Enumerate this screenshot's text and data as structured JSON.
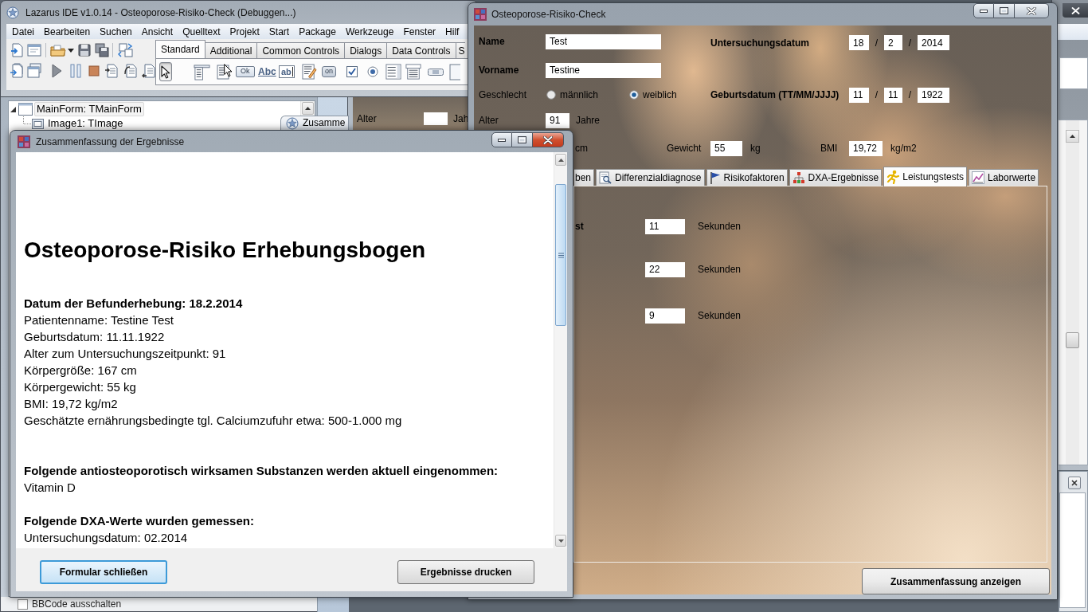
{
  "ide": {
    "title": "Lazarus IDE v1.0.14 - Osteoporose-Risiko-Check (Debuggen...)",
    "menu": [
      "Datei",
      "Bearbeiten",
      "Suchen",
      "Ansicht",
      "Quelltext",
      "Projekt",
      "Start",
      "Package",
      "Werkzeuge",
      "Fenster",
      "Hilf"
    ],
    "palette_tabs": [
      {
        "label": "Standard",
        "selected": true
      },
      {
        "label": "Additional",
        "selected": false
      },
      {
        "label": "Common Controls",
        "selected": false
      },
      {
        "label": "Dialogs",
        "selected": false
      },
      {
        "label": "Data Controls",
        "selected": false
      },
      {
        "label": "S",
        "selected": false
      }
    ],
    "palette": [
      {
        "kind": "pointer",
        "selected": true
      },
      {
        "kind": "main-menu",
        "selected": false
      },
      {
        "kind": "popup-menu",
        "selected": false
      },
      {
        "kind": "button",
        "text": "Ok",
        "selected": false
      },
      {
        "kind": "label",
        "text": "Abc",
        "selected": false
      },
      {
        "kind": "edit",
        "text": "ab",
        "selected": false
      },
      {
        "kind": "memo",
        "selected": false
      },
      {
        "kind": "toggle",
        "text": "on",
        "selected": false
      },
      {
        "kind": "checkbox",
        "selected": false
      },
      {
        "kind": "radio",
        "selected": false
      },
      {
        "kind": "listbox",
        "selected": false
      },
      {
        "kind": "combobox",
        "selected": false
      },
      {
        "kind": "scrollbar",
        "selected": false
      },
      {
        "kind": "panel",
        "selected": false
      }
    ]
  },
  "object_tree": {
    "items": [
      {
        "label": "MainForm: TMainForm",
        "selected": true,
        "expanded": true,
        "children": [
          {
            "label": "Image1: TImage",
            "selected": false
          }
        ]
      }
    ]
  },
  "inspector_option": {
    "label": "BBCode ausschalten",
    "checked": false
  },
  "editor_tab": {
    "label": "Zusamme"
  },
  "designer": {
    "label": "Alter",
    "unit": "Jah"
  },
  "main_form": {
    "title": "Osteoporose-Risiko-Check",
    "active": false,
    "name": {
      "label": "Name",
      "value": "Test"
    },
    "first_name": {
      "label": "Vorname",
      "value": "Testine"
    },
    "exam_date": {
      "label": "Untersuchungsdatum",
      "parts": [
        "18",
        "2",
        "2014"
      ],
      "separators": [
        "/",
        "/"
      ]
    },
    "gender": {
      "label": "Geschlecht",
      "options": [
        {
          "label": "männlich",
          "selected": false
        },
        {
          "label": "weiblich",
          "selected": true
        }
      ]
    },
    "birth_date": {
      "label": "Geburtsdatum (TT/MM/JJJJ)",
      "parts": [
        "11",
        "11",
        "1922"
      ],
      "separators": [
        "/",
        "/"
      ]
    },
    "age": {
      "label": "Alter",
      "value": "91",
      "unit": "Jahre"
    },
    "measurements": [
      {
        "unit": "cm"
      },
      {
        "label": "Gewicht",
        "value": "55",
        "unit": "kg"
      },
      {
        "label": "BMI",
        "value": "19,72",
        "unit": "kg/m2"
      }
    ],
    "tabs": [
      {
        "label": "ben",
        "selected": false
      },
      {
        "label": "Differenzialdiagnose",
        "selected": false
      },
      {
        "label": "Risikofaktoren",
        "selected": false
      },
      {
        "label": "DXA-Ergebnisse",
        "selected": false
      },
      {
        "label": "Leistungstests",
        "selected": true
      },
      {
        "label": "Laborwerte",
        "selected": false
      }
    ],
    "tests": [
      {
        "label": "st",
        "value": "11",
        "unit": "Sekunden"
      },
      {
        "value": "22",
        "unit": "Sekunden"
      },
      {
        "value": "9",
        "unit": "Sekunden"
      }
    ],
    "button": "Zusammenfassung anzeigen"
  },
  "summary": {
    "title": "Zusammenfassung der Ergebnisse",
    "active": true,
    "heading": "Osteoporose-Risiko Erhebungsbogen",
    "sections": [
      {
        "heading": "Datum der Befunderhebung: 18.2.2014",
        "lines": [
          "Patientenname: Testine Test",
          "Geburtsdatum: 11.11.1922",
          "Alter zum Untersuchungszeitpunkt: 91",
          "Körpergröße: 167 cm",
          "Körpergewicht: 55 kg",
          "BMI: 19,72 kg/m2",
          "Geschätzte ernährungsbedingte tgl. Calciumzufuhr etwa: 500-1.000 mg"
        ]
      },
      {
        "heading": "Folgende antiosteoporotisch wirksamen Substanzen werden aktuell eingenommen:",
        "lines": [
          "Vitamin D"
        ]
      },
      {
        "heading": "Folgende DXA-Werte wurden gemessen:",
        "lines": [
          "Untersuchungsdatum: 02.2014"
        ]
      }
    ],
    "buttons": [
      {
        "label": "Formular schließen",
        "focused": true
      },
      {
        "label": "Ergebnisse drucken",
        "focused": false
      }
    ]
  }
}
